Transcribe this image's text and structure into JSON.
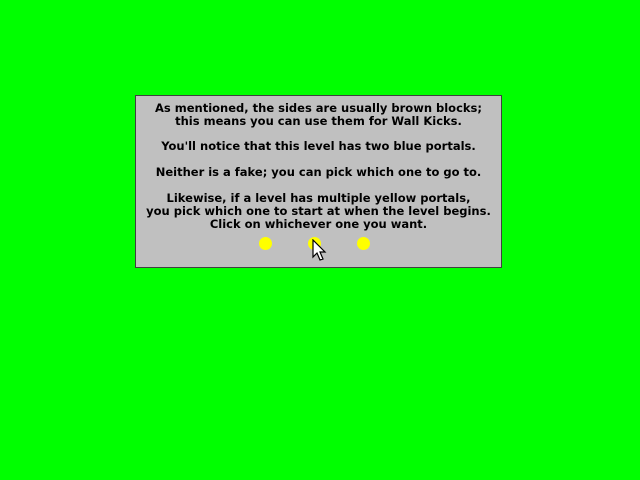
{
  "colors": {
    "background": "#00ff00",
    "dialog_background": "#c0c0c0",
    "portal": "#ffff00"
  },
  "dialog": {
    "paragraph1": [
      "As mentioned, the sides are usually brown blocks;",
      "this means you can use them for Wall Kicks."
    ],
    "paragraph2": [
      "You'll notice that this level has two blue portals."
    ],
    "paragraph3": [
      "Neither is a fake; you can pick which one to go to."
    ],
    "paragraph4": [
      "Likewise, if a level has multiple yellow portals,",
      "you pick which one to start at when the level begins.",
      "Click on whichever one you want."
    ]
  },
  "portals": [
    {
      "icon": "yellow-portal-icon"
    },
    {
      "icon": "yellow-portal-icon"
    },
    {
      "icon": "yellow-portal-icon"
    }
  ],
  "cursor": {
    "icon": "arrow-cursor-icon"
  }
}
